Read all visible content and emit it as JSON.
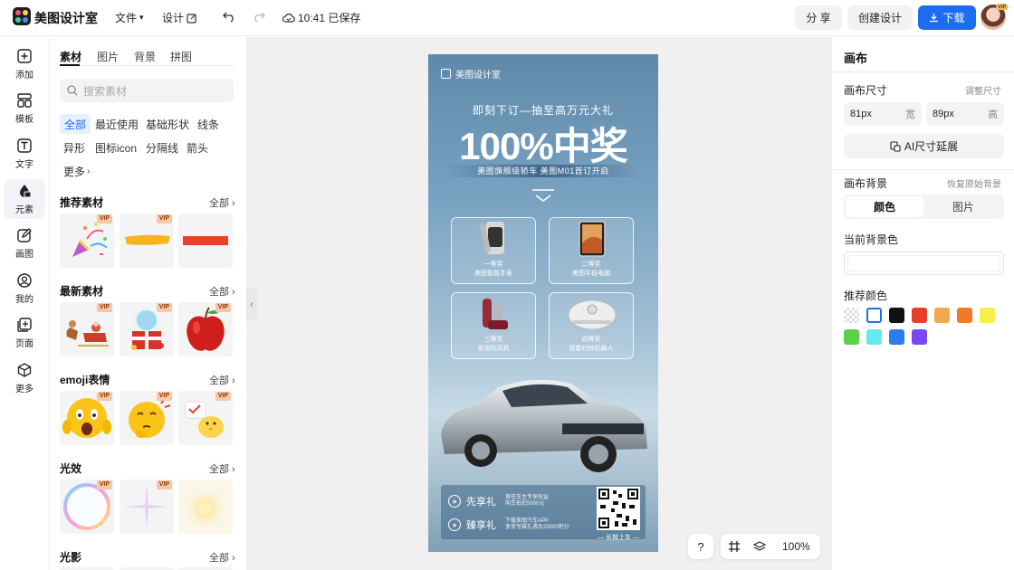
{
  "app": {
    "name": "美图设计室",
    "menu_file": "文件",
    "menu_design": "设计",
    "save_status": "10:41 已保存",
    "share": "分 享",
    "create_design": "创建设计",
    "download": "下载",
    "avatar_badge": "VIP"
  },
  "leftnav": [
    {
      "label": "添加",
      "icon": "plus-square-icon"
    },
    {
      "label": "模板",
      "icon": "template-icon"
    },
    {
      "label": "文字",
      "icon": "text-icon"
    },
    {
      "label": "元素",
      "icon": "shapes-icon"
    },
    {
      "label": "画图",
      "icon": "pen-icon"
    },
    {
      "label": "我的",
      "icon": "user-icon"
    },
    {
      "label": "页面",
      "icon": "add-page-icon"
    },
    {
      "label": "更多",
      "icon": "cube-icon"
    }
  ],
  "panel": {
    "tabs": [
      "素材",
      "图片",
      "背景",
      "拼图"
    ],
    "search_placeholder": "搜索素材",
    "chips": [
      "全部",
      "最近使用",
      "基础形状",
      "线条",
      "异形",
      "图标icon",
      "分隔线",
      "箭头",
      "更多"
    ],
    "all_label": "全部",
    "sections": [
      {
        "title": "推荐素材",
        "items": [
          "confetti-popper",
          "yellow-brush-stroke",
          "red-bar"
        ],
        "vip": [
          true,
          true,
          false
        ]
      },
      {
        "title": "最新素材",
        "items": [
          "santa-sleigh",
          "gift-snowglobe",
          "red-apple"
        ],
        "vip": [
          true,
          true,
          true
        ]
      },
      {
        "title": "emoji表情",
        "items": [
          "scared-emoji",
          "thinking-emoji",
          "chick-emoji"
        ],
        "vip": [
          true,
          true,
          true
        ]
      },
      {
        "title": "光效",
        "items": [
          "rainbow-bubble",
          "sparkle-star",
          "glow-light"
        ],
        "vip": [
          true,
          true,
          false
        ]
      },
      {
        "title": "光影",
        "items": [],
        "vip": []
      }
    ],
    "vip_label": "VIP"
  },
  "poster": {
    "brand": "美图设计室",
    "headline_sub": "即刻下订—抽至高万元大礼",
    "headline": "100%中奖",
    "banner": "美图旗舰级轿车 美图M01首订开启",
    "prizes": [
      {
        "line1": "一等奖",
        "line2": "美图智能手表"
      },
      {
        "line1": "二等奖",
        "line2": "美图平板电脑"
      },
      {
        "line1": "三等奖",
        "line2": "家用吹风机"
      },
      {
        "line1": "四等奖",
        "line2": "智能扫地机器人"
      }
    ],
    "footer": [
      {
        "label": "先享礼",
        "desc1": "首任车主专享权益",
        "desc2": "购车抵扣5000元"
      },
      {
        "label": "臻享礼",
        "desc1": "下载美图汽车APP",
        "desc2": "享受专属礼遇及20000积分"
      }
    ],
    "qr_caption": "— 长按上车 —"
  },
  "canvas_tools": {
    "help": "?",
    "zoom": "100%"
  },
  "right_panel": {
    "title": "画布",
    "size_label": "画布尺寸",
    "size_adjust": "调整尺寸",
    "width_value": "81px",
    "width_unit": "宽",
    "height_value": "89px",
    "height_unit": "高",
    "ai_extend": "AI尺寸延展",
    "bg_label": "画布背景",
    "bg_reset": "恢复原始背景",
    "seg_color": "颜色",
    "seg_image": "图片",
    "current_bg_label": "当前背景色",
    "recommended_label": "推荐颜色",
    "swatches": [
      "transparent",
      "#ffffff",
      "#111111",
      "#e8402a",
      "#f3a84b",
      "#f07a29",
      "#f6ee4a",
      "#5bd14a",
      "#63e9ee",
      "#2b7cf0",
      "#7a4af0"
    ]
  },
  "colors": {
    "accent": "#1e6cf0"
  }
}
